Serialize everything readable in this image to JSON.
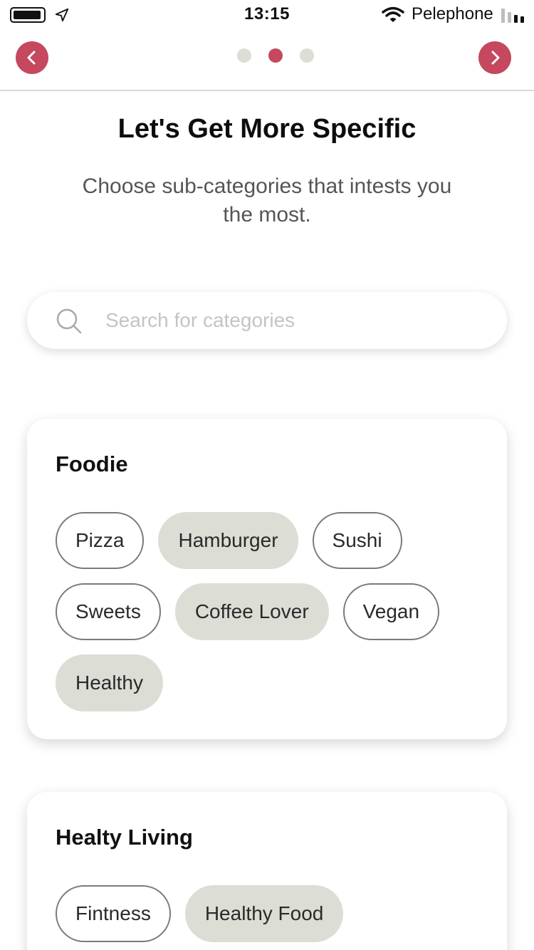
{
  "status_bar": {
    "time": "13:15",
    "carrier": "Pelephone"
  },
  "nav": {
    "back_icon": "chevron-left-icon",
    "next_icon": "chevron-right-icon",
    "page_count": 3,
    "active_page": 2,
    "accent_color": "#c5485e",
    "inactive_dot_color": "#dcddd5"
  },
  "header": {
    "title": "Let's Get More Specific",
    "subtitle": "Choose sub-categories that intests you the most."
  },
  "search": {
    "placeholder": "Search for categories",
    "value": ""
  },
  "categories": [
    {
      "title": "Foodie",
      "chips": [
        {
          "label": "Pizza",
          "selected": false
        },
        {
          "label": "Hamburger",
          "selected": true
        },
        {
          "label": "Sushi",
          "selected": false
        },
        {
          "label": "Sweets",
          "selected": false
        },
        {
          "label": "Coffee Lover",
          "selected": true
        },
        {
          "label": "Vegan",
          "selected": false
        },
        {
          "label": "Healthy",
          "selected": true
        }
      ]
    },
    {
      "title": "Healty Living",
      "chips": [
        {
          "label": "Fintness",
          "selected": false
        },
        {
          "label": "Healthy Food",
          "selected": true
        }
      ]
    }
  ],
  "colors": {
    "selected_chip": "#dcddd5",
    "chip_border": "#7a7a7a"
  }
}
